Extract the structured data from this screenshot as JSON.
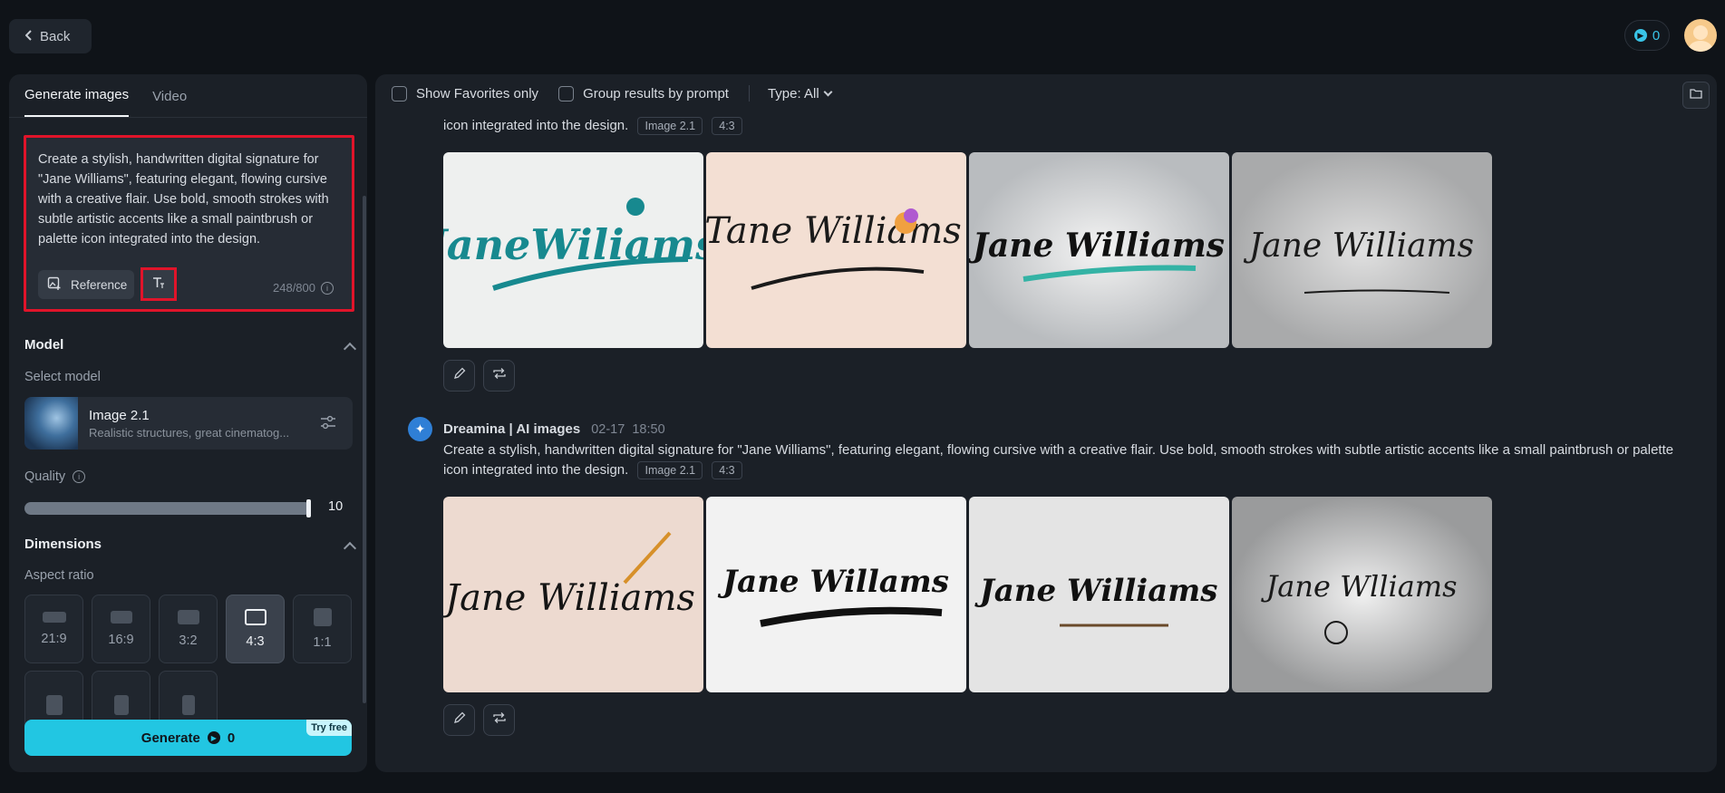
{
  "header": {
    "back_label": "Back",
    "credits": "0"
  },
  "left": {
    "tabs": [
      "Generate images",
      "Video"
    ],
    "prompt_text": "Create a stylish, handwritten digital signature for \"Jane Williams\", featuring elegant, flowing cursive with a creative flair. Use bold, smooth strokes with subtle artistic accents like a small paintbrush or palette icon integrated into the design.",
    "reference_label": "Reference",
    "counter": "248/800",
    "model_title": "Model",
    "select_model_label": "Select model",
    "model_name": "Image 2.1",
    "model_desc": "Realistic structures, great cinematog...",
    "quality_label": "Quality",
    "quality_value": "10",
    "quality_level": 1.0,
    "dimensions_title": "Dimensions",
    "aspect_label": "Aspect ratio",
    "ratios": [
      "21:9",
      "16:9",
      "3:2",
      "4:3",
      "1:1"
    ],
    "selected_ratio": "4:3",
    "generate_label": "Generate",
    "generate_cost": "0",
    "try_free": "Try free"
  },
  "right": {
    "show_favorites": "Show Favorites only",
    "group_results": "Group results by prompt",
    "type_label": "Type: All",
    "group1": {
      "prompt_tail": "icon integrated into the design.",
      "tags": [
        "Image 2.1",
        "4:3"
      ],
      "image_texts": [
        "JaneWiliams",
        "Tane Williams",
        "Jane Williams",
        "Jane Williams"
      ]
    },
    "group2": {
      "author": "Dreamina | AI images",
      "date": "02-17",
      "time": "18:50",
      "prompt_line1": "Create a stylish, handwritten digital signature for \"Jane Williams\", featuring elegant, flowing cursive with a creative flair. Use bold, smooth strokes with subtle artistic accents like a small paintbrush or palette",
      "prompt_line2": "icon integrated into the design.",
      "tags": [
        "Image 2.1",
        "4:3"
      ],
      "image_texts": [
        "Jane Williams",
        "Jane Willams",
        "Jane Williams",
        "Jane Wlliams"
      ]
    }
  },
  "colors": {
    "accent": "#22c6e2",
    "highlight_border": "#e0142a",
    "background": "#0f1318",
    "panel": "#1b2027"
  }
}
